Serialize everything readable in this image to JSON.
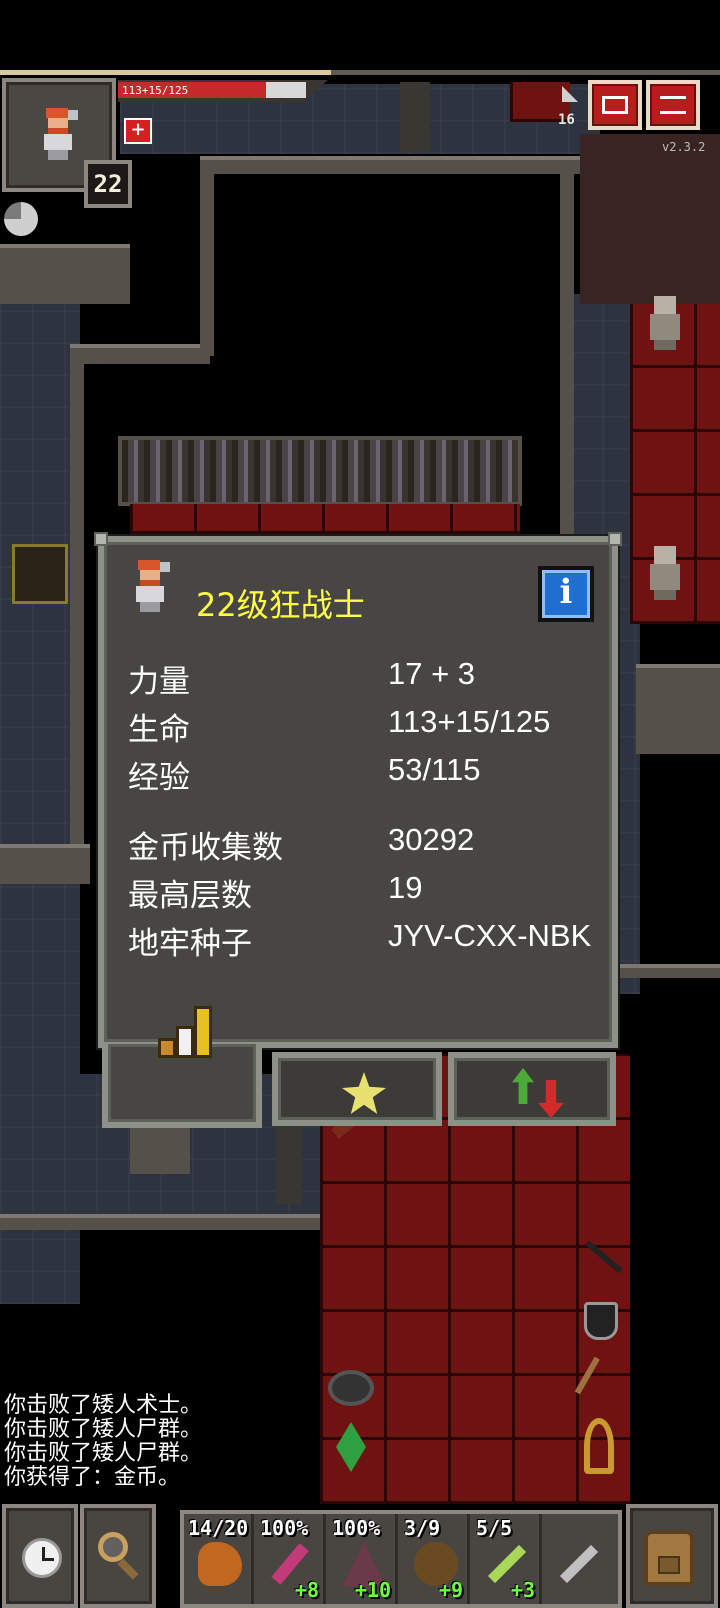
{
  "hud": {
    "hp_text": "113+15/125",
    "hp_fraction": 0.904,
    "xp_fraction": 0.46,
    "level": "22",
    "depth": "16",
    "version": "v2.3.2",
    "buff_icon": "health-buff-icon",
    "journal_icon": "journal-icon",
    "menu_icon": "menu-icon"
  },
  "window": {
    "title": "22级狂战士",
    "info_icon": "i",
    "stats": [
      {
        "label": "力量",
        "value": "17 + 3"
      },
      {
        "label": "生命",
        "value": "113+15/125"
      },
      {
        "label": "经验",
        "value": "53/115"
      }
    ],
    "records": [
      {
        "label": "金币收集数",
        "value": "30292"
      },
      {
        "label": "最高层数",
        "value": "19"
      },
      {
        "label": "地牢种子",
        "value": "JYV-CXX-NBK"
      }
    ],
    "tabs": [
      "stats-tab",
      "badges-tab",
      "buffs-tab"
    ]
  },
  "log": [
    "你击败了矮人术士。",
    "你击败了矮人尸群。",
    "你击败了矮人尸群。",
    "你获得了：金币。"
  ],
  "toolbar": {
    "wait_icon": "clock-icon",
    "search_icon": "magnifier-icon",
    "inventory_icon": "backpack-icon",
    "quickslots": [
      {
        "top": "14/20",
        "bottom": "",
        "icon": "horn-of-plenty-icon",
        "color": "#c2671f"
      },
      {
        "top": "100%",
        "bottom": "+8",
        "icon": "wand-icon",
        "color": "#c23a7a"
      },
      {
        "top": "100%",
        "bottom": "+10",
        "icon": "cloak-icon",
        "color": "#6a3a4a"
      },
      {
        "top": "3/9",
        "bottom": "+9",
        "icon": "trinket-icon",
        "color": "#6a4a20"
      },
      {
        "top": "5/5",
        "bottom": "+3",
        "icon": "wand-icon",
        "color": "#a8d85a"
      },
      {
        "top": "",
        "bottom": "",
        "icon": "dagger-icon",
        "color": "#c0c0c0"
      }
    ]
  }
}
